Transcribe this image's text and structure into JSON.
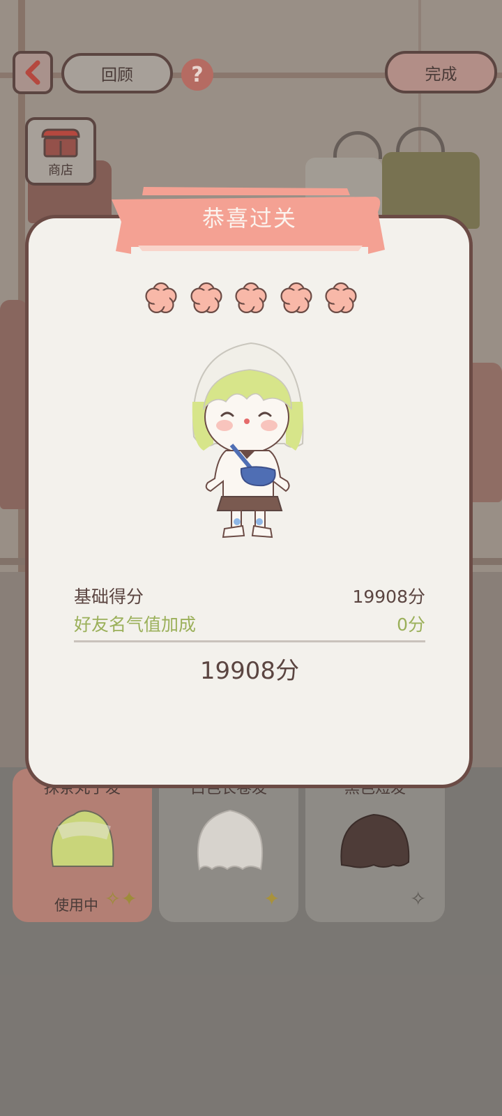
{
  "topbar": {
    "review_label": "回顾",
    "done_label": "完成",
    "help_glyph": "?",
    "shop_label": "商店"
  },
  "dialog": {
    "title": "恭喜过关",
    "stars_earned": 5,
    "stars_total": 5,
    "base_score_label": "基础得分",
    "base_score_value": "19908分",
    "friend_bonus_label": "好友名气值加成",
    "friend_bonus_value": "0分",
    "total_score": "19908分"
  },
  "items": [
    {
      "name": "抹茶丸子发",
      "status": "使用中",
      "hair_color": "#c9d57a",
      "active": true
    },
    {
      "name": "白色长卷发",
      "status": "",
      "hair_color": "#ece9e4",
      "active": false
    },
    {
      "name": "黑色短发",
      "status": "",
      "hair_color": "#4e3c38",
      "active": false
    }
  ],
  "colors": {
    "accent_pink": "#f4a193",
    "dialog_bg": "#f3f1ec",
    "border_brown": "#6b4b45",
    "bonus_green": "#9bb05a",
    "star_fill": "#f8b8a8"
  },
  "icons": {
    "back": "chevron-left-icon",
    "help": "question-icon",
    "shop": "shop-icon",
    "star": "flower-star-icon",
    "sparkle": "sparkle-icon"
  }
}
